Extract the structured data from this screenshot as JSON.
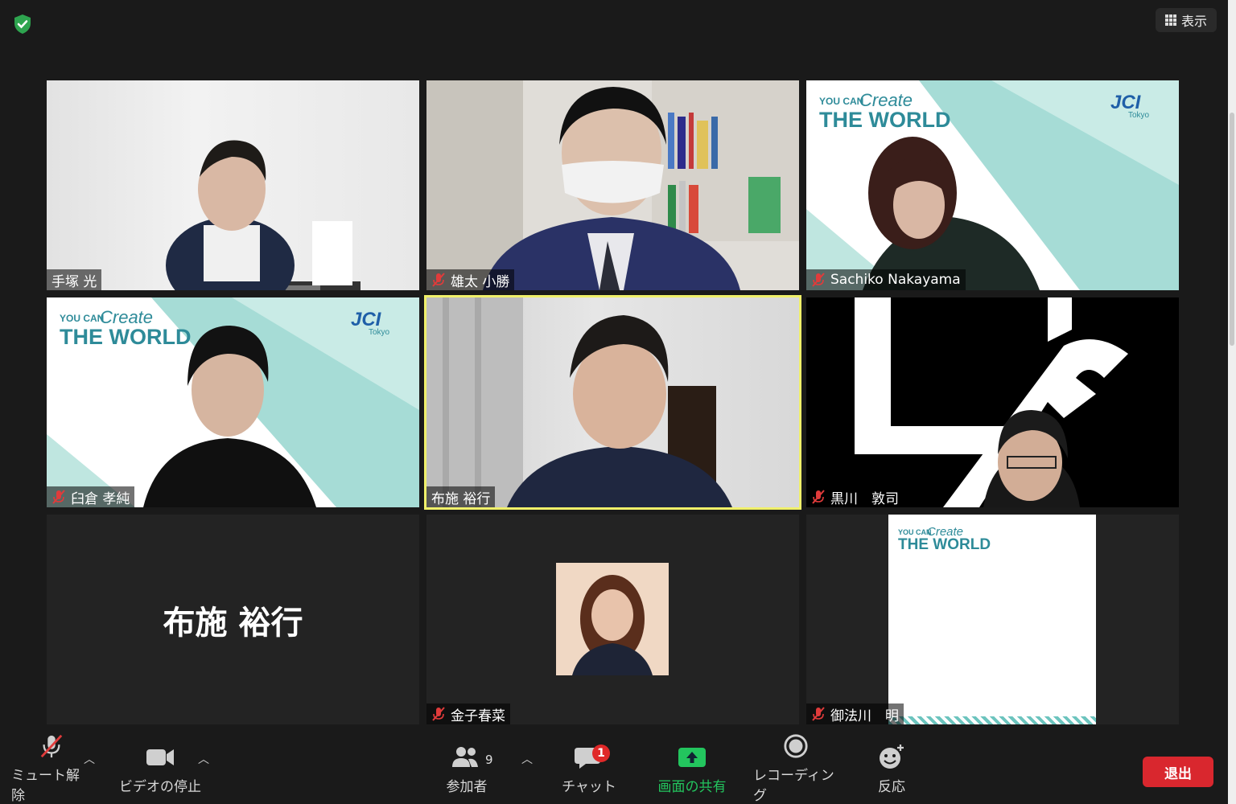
{
  "topbar": {
    "view_label": "表示",
    "accent_green": "#2ea44f"
  },
  "participants": [
    {
      "name": "手塚 光",
      "muted": false
    },
    {
      "name": "雄太 小勝",
      "muted": true
    },
    {
      "name": "Sachiko Nakayama",
      "muted": true
    },
    {
      "name": "臼倉 孝純",
      "muted": true
    },
    {
      "name": "布施 裕行",
      "muted": false,
      "active_speaker": true
    },
    {
      "name": "黒川　敦司",
      "muted": true
    },
    {
      "name": "布施 裕行",
      "video_off": true,
      "display_name": "布施 裕行"
    },
    {
      "name": "金子春菜",
      "muted": true
    },
    {
      "name": "御法川　明",
      "muted": true
    }
  ],
  "background_text": {
    "you_can": "YOU CAN",
    "create": "Create",
    "the_world": "THE WORLD",
    "logo": "JCI",
    "logo_sub": "Tokyo"
  },
  "toolbar": {
    "unmute_label": "ミュート解除",
    "video_label": "ビデオの停止",
    "participants_label": "参加者",
    "participants_count": "9",
    "chat_label": "チャット",
    "chat_badge": "1",
    "share_label": "画面の共有",
    "record_label": "レコーディング",
    "reactions_label": "反応",
    "leave_label": "退出",
    "share_color": "#23c55e",
    "leave_color": "#d9272e"
  }
}
